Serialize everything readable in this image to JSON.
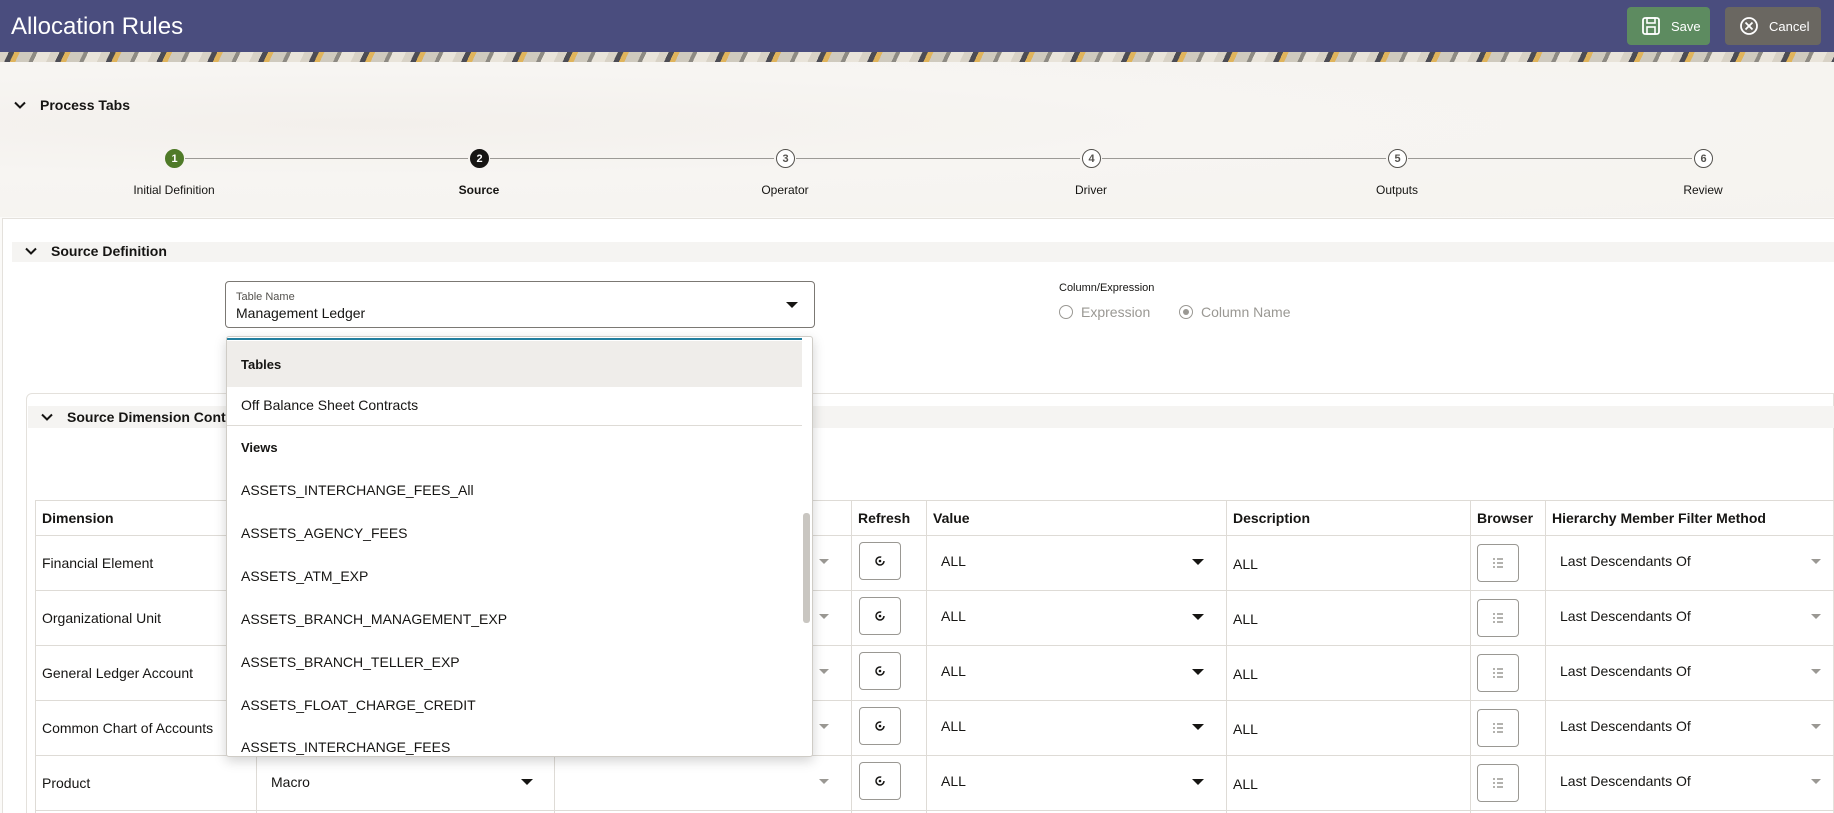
{
  "header": {
    "title": "Allocation Rules",
    "save_label": "Save",
    "cancel_label": "Cancel",
    "colors": {
      "bar": "#4a4d7e",
      "save": "#5d8b60",
      "cancel": "#6a6761"
    }
  },
  "process_tabs": {
    "label": "Process Tabs",
    "steps": [
      {
        "num": "1",
        "label": "Initial Definition",
        "state": "done"
      },
      {
        "num": "2",
        "label": "Source",
        "state": "current"
      },
      {
        "num": "3",
        "label": "Operator",
        "state": "pending"
      },
      {
        "num": "4",
        "label": "Driver",
        "state": "pending"
      },
      {
        "num": "5",
        "label": "Outputs",
        "state": "pending"
      },
      {
        "num": "6",
        "label": "Review",
        "state": "pending"
      }
    ]
  },
  "source_definition": {
    "label": "Source Definition",
    "table_name": {
      "label": "Table Name",
      "value": "Management Ledger"
    },
    "column_expression": {
      "label": "Column/Expression",
      "options": [
        {
          "label": "Expression",
          "selected": false
        },
        {
          "label": "Column Name",
          "selected": true
        }
      ]
    }
  },
  "dropdown": {
    "groups": [
      {
        "header": "Tables",
        "items": [
          "Off Balance Sheet Contracts"
        ]
      },
      {
        "header": "Views",
        "items": [
          "ASSETS_INTERCHANGE_FEES_All",
          "ASSETS_AGENCY_FEES",
          "ASSETS_ATM_EXP",
          "ASSETS_BRANCH_MANAGEMENT_EXP",
          "ASSETS_BRANCH_TELLER_EXP",
          "ASSETS_FLOAT_CHARGE_CREDIT",
          "ASSETS_INTERCHANGE_FEES"
        ]
      }
    ]
  },
  "dimension_controls": {
    "label": "Source Dimension Cont",
    "columns": [
      "Dimension",
      "Refresh",
      "Value",
      "Description",
      "Browser",
      "Hierarchy Member Filter Method"
    ],
    "rows": [
      {
        "dimension": "Financial Element",
        "filter": "",
        "value": "ALL",
        "description": "ALL",
        "method": "Last Descendants Of"
      },
      {
        "dimension": "Organizational Unit",
        "filter": "",
        "value": "ALL",
        "description": "ALL",
        "method": "Last Descendants Of"
      },
      {
        "dimension": "General Ledger Account",
        "filter": "",
        "value": "ALL",
        "description": "ALL",
        "method": "Last Descendants Of"
      },
      {
        "dimension": "Common Chart of Accounts",
        "filter": "",
        "value": "ALL",
        "description": "ALL",
        "method": "Last Descendants Of"
      },
      {
        "dimension": "Product",
        "filter": "Macro",
        "value": "ALL",
        "description": "ALL",
        "method": "Last Descendants Of"
      }
    ]
  }
}
